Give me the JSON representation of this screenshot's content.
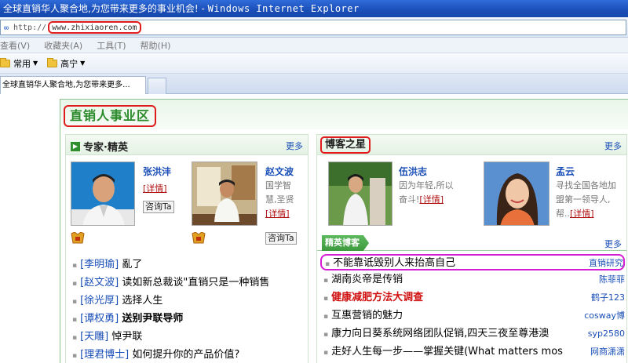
{
  "window": {
    "title_site": "全球直销华人聚合地,为您带来更多的事业机会!",
    "title_sep": " - ",
    "title_app": "Windows Internet Explorer"
  },
  "address": {
    "prefix": "http://",
    "url": "www.zhixiaoren.com"
  },
  "menu": [
    "查看(V)",
    "收藏夹(A)",
    "工具(T)",
    "帮助(H)"
  ],
  "favorites": [
    {
      "label": "常用"
    },
    {
      "label": "高宁"
    }
  ],
  "tab": {
    "label": "全球直销华人聚合地,为您带来更多..."
  },
  "page": {
    "section_title": "直销人事业区",
    "experts": {
      "title": "专家·精英",
      "more": "更多",
      "people": [
        {
          "name": "张洪沣",
          "detail": "[详情]",
          "ask": "咨询Ta"
        },
        {
          "name": "赵文波",
          "desc1": "国学智",
          "desc2": "慧,圣贤",
          "detail": "[详情]",
          "ask": "咨询Ta"
        }
      ],
      "articles": [
        {
          "tag": "[李明瑜]",
          "title": "亂了",
          "bold": false
        },
        {
          "tag": "[赵文波]",
          "title": "读如新总裁谈\"直销只是一种销售",
          "bold": false
        },
        {
          "tag": "[徐光厚]",
          "title": "选择人生",
          "bold": false
        },
        {
          "tag": "[谭权勇]",
          "title": "送别尹联导师",
          "bold": true
        },
        {
          "tag": "[天雕]",
          "title": "悼尹联",
          "bold": false
        },
        {
          "tag": "[理君博士]",
          "title": "如何提升你的产品价值?",
          "bold": false
        }
      ]
    },
    "bloggers": {
      "title": "博客之星",
      "more": "更多",
      "people": [
        {
          "name": "伍洪志",
          "desc1": "因为年轻,所以",
          "desc2": "奋斗!",
          "detail": "[详情]"
        },
        {
          "name": "孟云",
          "desc1": "寻找全国各地加",
          "desc2": "盟第一领导人,",
          "desc3": "帮..",
          "detail": "[详情]"
        }
      ],
      "sub_title": "精英博客",
      "sub_more": "更多",
      "posts": [
        {
          "title": "不能靠诋毁别人来抬高自己",
          "author": "直销研究",
          "highlight": true,
          "red": false
        },
        {
          "title": "湖南炎帝是传销",
          "author": "陈菲菲",
          "highlight": false,
          "red": false
        },
        {
          "title": "健康减肥方法大调查",
          "author": "鹤子123",
          "highlight": false,
          "red": true
        },
        {
          "title": "互惠营销的魅力",
          "author": "cosway博",
          "highlight": false,
          "red": false
        },
        {
          "title": "康力向日葵系统网络团队促销,四天三夜至尊港澳",
          "author": "syp2580",
          "highlight": false,
          "red": false
        },
        {
          "title": "走好人生每一步——掌握关键(What matters mos",
          "author": "网商潇潇",
          "highlight": false,
          "red": false
        }
      ]
    }
  },
  "colors": {
    "accent_red": "#e01b1b",
    "highlight_magenta": "#d51cd5",
    "brand_green": "#2a8a2a",
    "link_blue": "#1a4fb8"
  }
}
